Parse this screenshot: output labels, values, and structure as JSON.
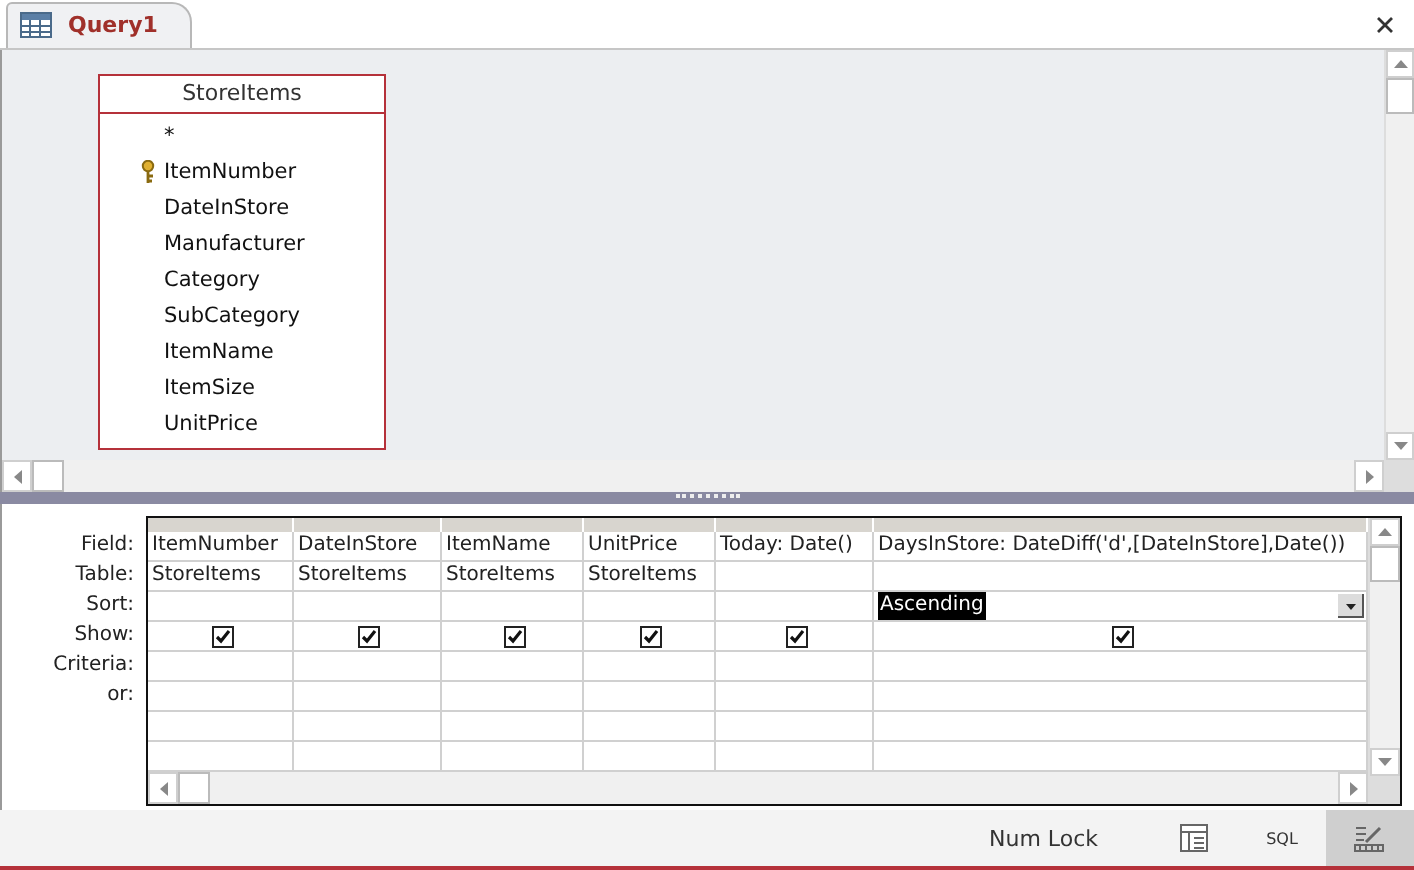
{
  "tab": {
    "title": "Query1"
  },
  "table_box": {
    "title": "StoreItems",
    "fields": [
      {
        "name": "*",
        "primary_key": false
      },
      {
        "name": "ItemNumber",
        "primary_key": true
      },
      {
        "name": "DateInStore",
        "primary_key": false
      },
      {
        "name": "Manufacturer",
        "primary_key": false
      },
      {
        "name": "Category",
        "primary_key": false
      },
      {
        "name": "SubCategory",
        "primary_key": false
      },
      {
        "name": "ItemName",
        "primary_key": false
      },
      {
        "name": "ItemSize",
        "primary_key": false
      },
      {
        "name": "UnitPrice",
        "primary_key": false
      }
    ]
  },
  "grid": {
    "row_labels": [
      "Field:",
      "Table:",
      "Sort:",
      "Show:",
      "Criteria:",
      "or:"
    ],
    "columns": [
      {
        "field": "ItemNumber",
        "table": "StoreItems",
        "show": true
      },
      {
        "field": "DateInStore",
        "table": "StoreItems",
        "show": true
      },
      {
        "field": "ItemName",
        "table": "StoreItems",
        "show": true
      },
      {
        "field": "UnitPrice",
        "table": "StoreItems",
        "show": true
      },
      {
        "field": "Today: Date()",
        "show": true
      },
      {
        "field": "DaysInStore: DateDiff('d',[DateInStore],Date())",
        "sort": "Ascending",
        "sort_open": true,
        "show": true
      }
    ]
  },
  "status_bar": {
    "text": "Num Lock",
    "views": [
      {
        "kind": "datasheet",
        "selected": false
      },
      {
        "kind": "sql",
        "label": "SQL",
        "selected": false
      },
      {
        "kind": "design",
        "selected": true
      }
    ]
  }
}
